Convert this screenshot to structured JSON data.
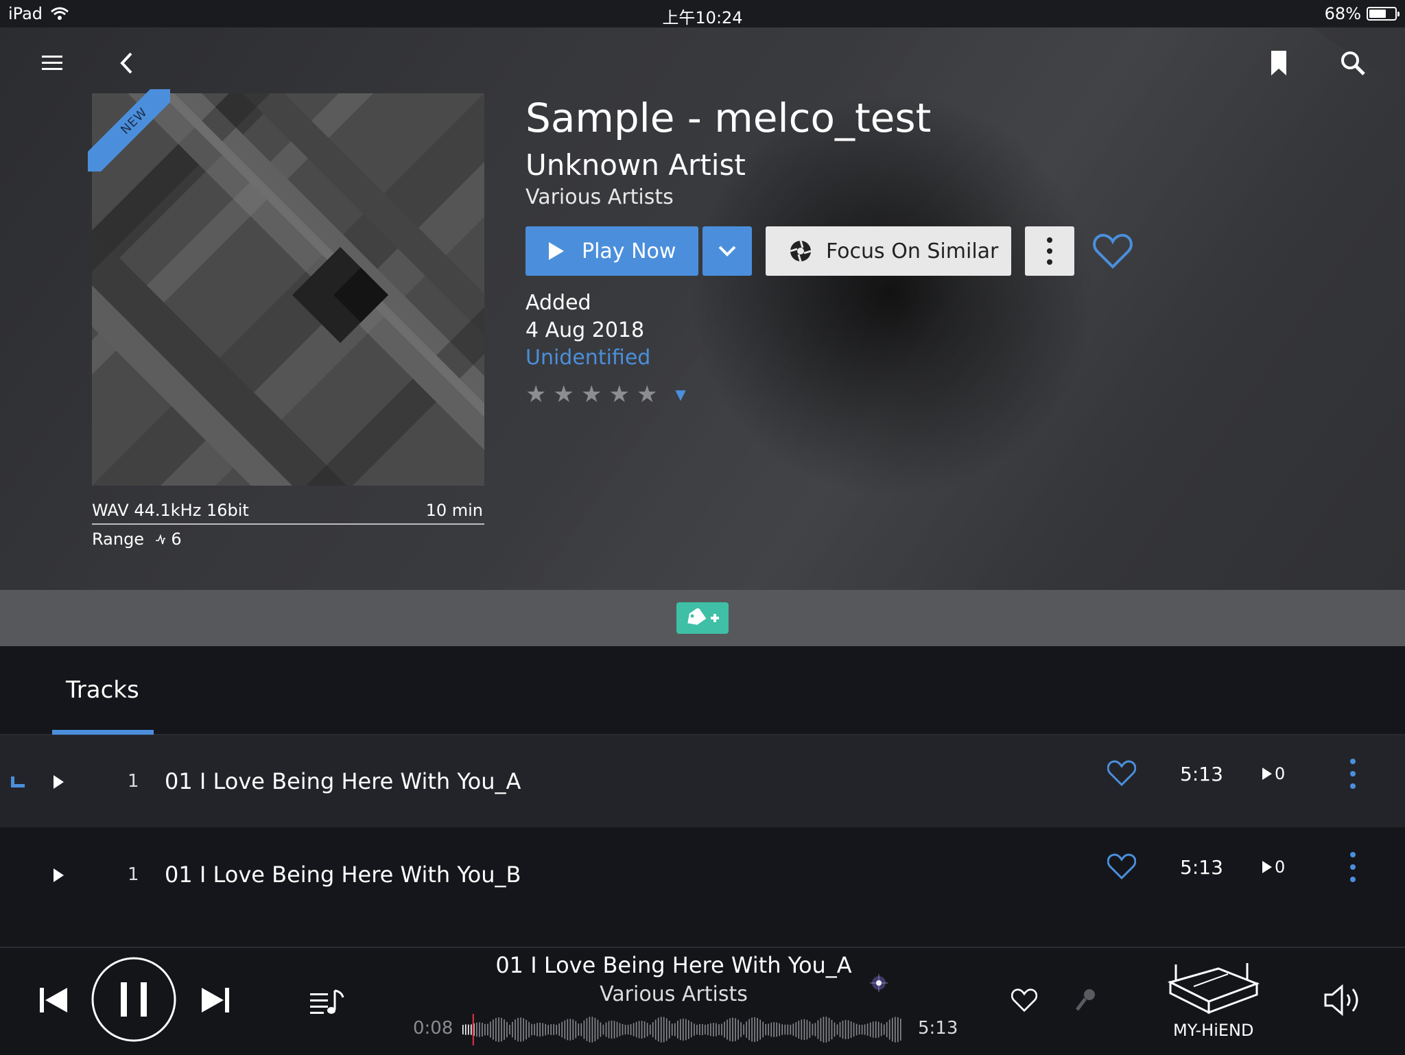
{
  "status_bar": {
    "device": "iPad",
    "time": "上午10:24",
    "battery": "68%",
    "battery_level": 0.68
  },
  "album": {
    "badge": "NEW",
    "title": "Sample - melco_test",
    "artist": "Unknown Artist",
    "album_artist": "Various Artists",
    "format": "WAV 44.1kHz 16bit",
    "duration": "10 min",
    "range_label": "Range",
    "range_value": "6",
    "added_label": "Added",
    "added_date": "4 Aug 2018",
    "status_link": "Unidentified",
    "rating": 0,
    "rating_max": 5
  },
  "actions": {
    "play_now": "Play Now",
    "focus_on_similar": "Focus On Similar"
  },
  "tabs": [
    {
      "label": "Tracks",
      "active": true
    }
  ],
  "tracks": [
    {
      "number": "1",
      "title": "01 I Love Being Here With You_A",
      "duration": "5:13",
      "plays": "0",
      "now_playing": true
    },
    {
      "number": "1",
      "title": "01 I Love Being Here With You_B",
      "duration": "5:13",
      "plays": "0",
      "now_playing": false
    }
  ],
  "now_playing": {
    "title": "01 I Love Being Here With You_A",
    "artist": "Various Artists",
    "elapsed": "0:08",
    "total": "5:13",
    "progress": 0.026,
    "device": "MY-HiEND"
  },
  "colors": {
    "accent": "#4b8fdc",
    "tag": "#3fbfa6",
    "background": "#15161a"
  },
  "icons": [
    "menu-icon",
    "back-icon",
    "bookmark-icon",
    "search-icon",
    "play-icon",
    "chevron-down-icon",
    "focus-icon",
    "more-icon",
    "heart-icon",
    "tag-plus-icon",
    "previous-icon",
    "pause-icon",
    "next-icon",
    "queue-icon",
    "microphone-icon",
    "device-icon",
    "volume-icon"
  ]
}
